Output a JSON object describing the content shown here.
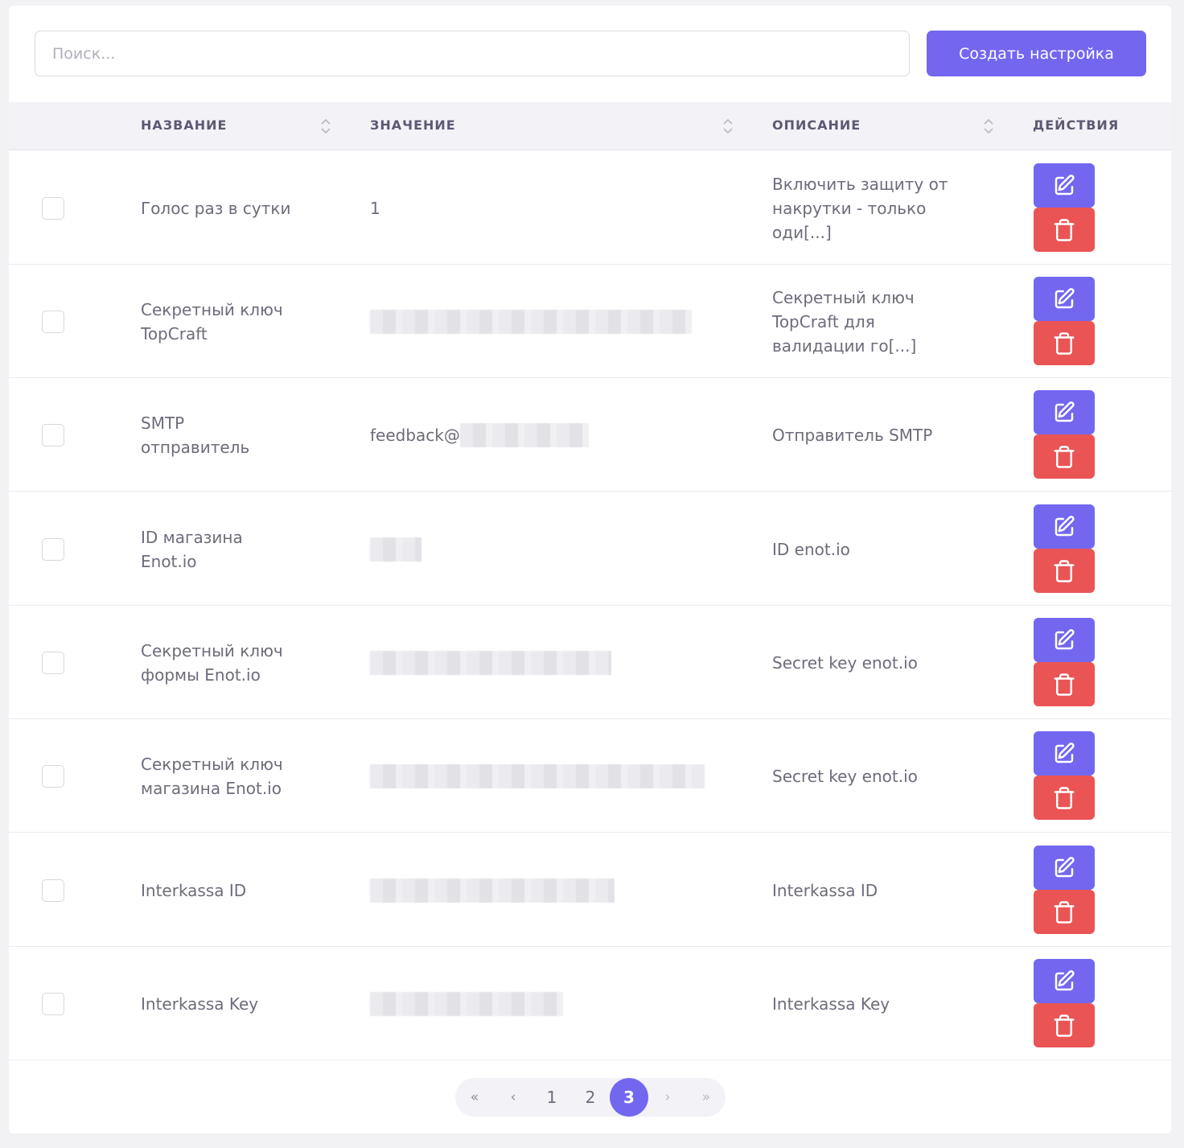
{
  "search": {
    "placeholder": "Поиск..."
  },
  "toolbar": {
    "create_label": "Создать настройка"
  },
  "colors": {
    "accent": "#7367f0",
    "danger": "#ea5455"
  },
  "table": {
    "headers": {
      "name": "НАЗВАНИЕ",
      "value": "ЗНАЧЕНИЕ",
      "description": "ОПИСАНИЕ",
      "actions": "ДЕЙСТВИЯ"
    },
    "rows": [
      {
        "name": [
          "Голос раз в сутки"
        ],
        "value": "1",
        "description": [
          "Включить защиту от",
          "накрутки - только",
          "оди[...]"
        ]
      },
      {
        "name": [
          "Секретный ключ",
          "TopCraft"
        ],
        "value": "",
        "description": [
          "Секретный ключ",
          "TopCraft для",
          "валидации го[...]"
        ]
      },
      {
        "name": [
          "SMTP",
          "отправитель"
        ],
        "value": "feedback@",
        "description": [
          "Отправитель SMTP"
        ]
      },
      {
        "name": [
          "ID магазина",
          "Enot.io"
        ],
        "value": "",
        "description": [
          "ID enot.io"
        ]
      },
      {
        "name": [
          "Секретный ключ",
          "формы Enot.io"
        ],
        "value": "",
        "description": [
          "Secret key enot.io"
        ]
      },
      {
        "name": [
          "Секретный ключ",
          "магазина Enot.io"
        ],
        "value": "",
        "description": [
          "Secret key enot.io"
        ]
      },
      {
        "name": [
          "Interkassa ID"
        ],
        "value": "",
        "description": [
          "Interkassa ID"
        ]
      },
      {
        "name": [
          "Interkassa Key"
        ],
        "value": "",
        "description": [
          "Interkassa Key"
        ]
      }
    ],
    "row_icons": {
      "edit": "edit-icon",
      "delete": "trash-icon"
    }
  },
  "pagination": {
    "first": "«",
    "prev": "‹",
    "pages": [
      "1",
      "2",
      "3"
    ],
    "current": "3",
    "next": "›",
    "last": "»"
  }
}
